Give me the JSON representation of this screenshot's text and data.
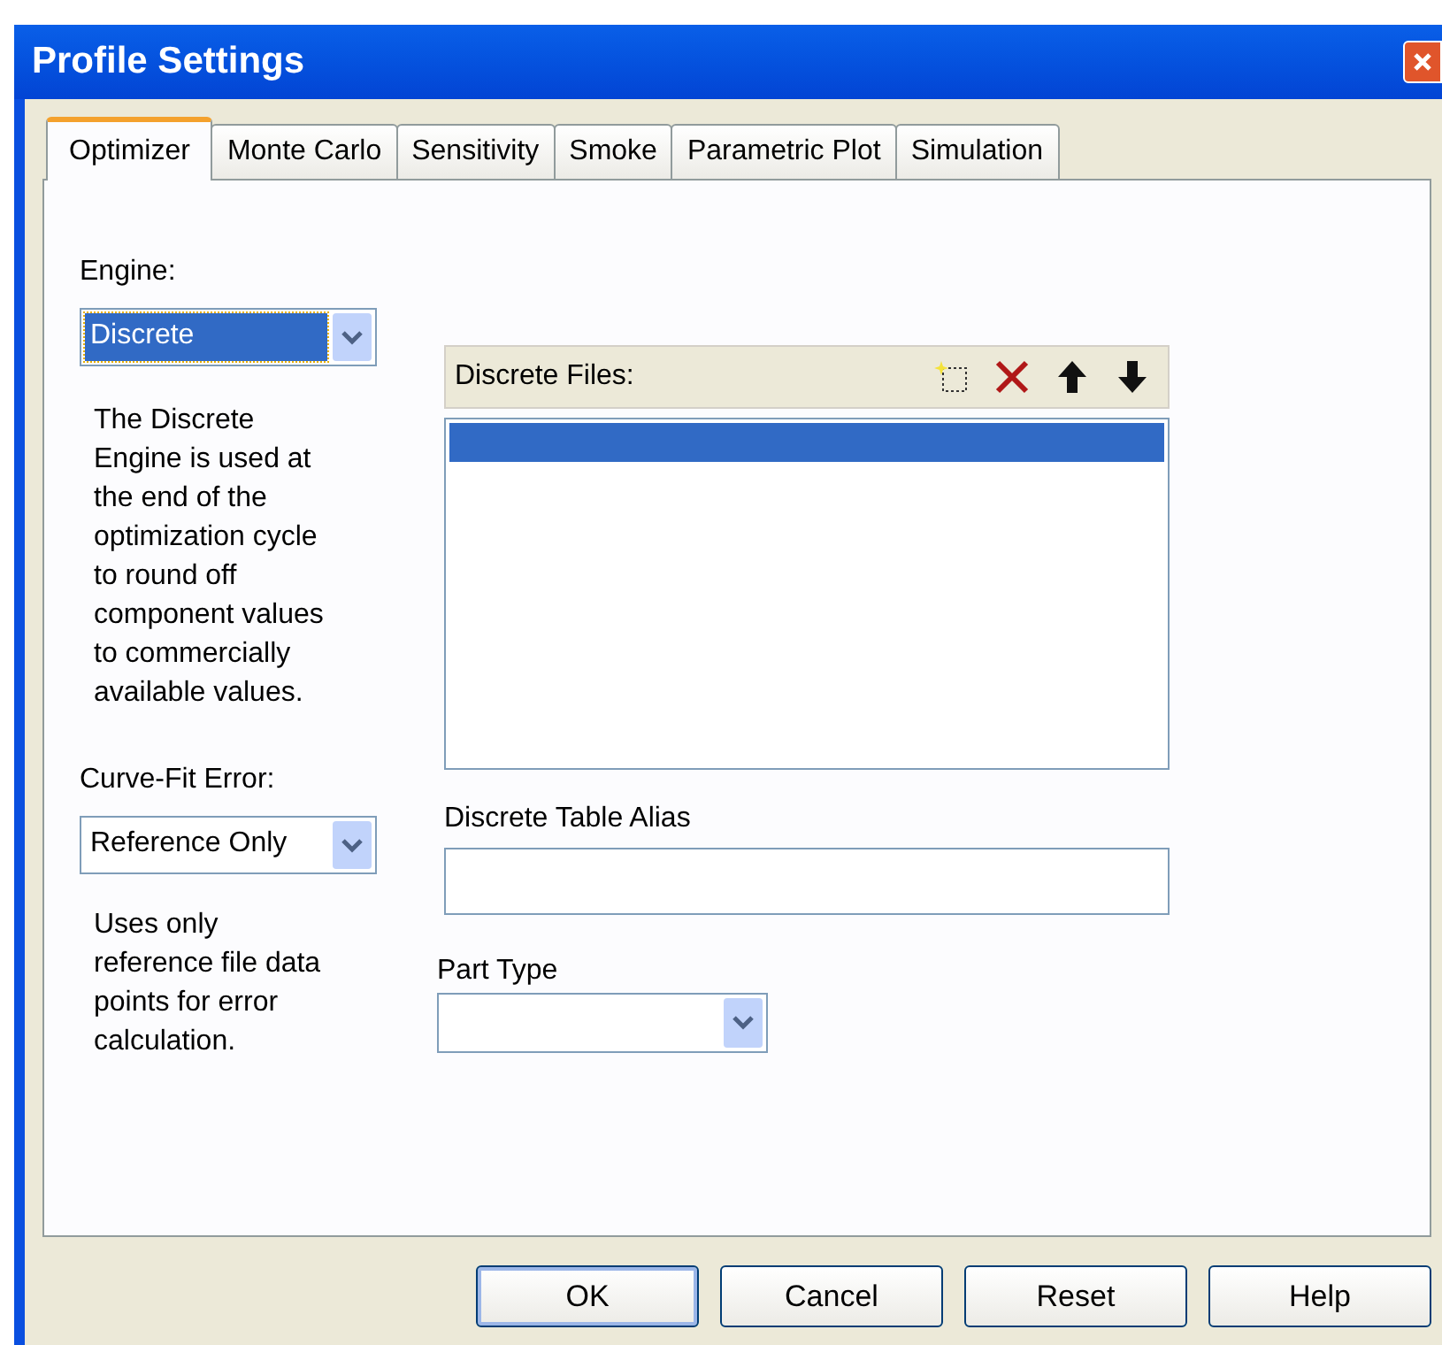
{
  "window": {
    "title": "Profile Settings"
  },
  "tabs": [
    {
      "label": "Optimizer",
      "selected": true
    },
    {
      "label": "Monte Carlo",
      "selected": false
    },
    {
      "label": "Sensitivity",
      "selected": false
    },
    {
      "label": "Smoke",
      "selected": false
    },
    {
      "label": "Parametric Plot",
      "selected": false
    },
    {
      "label": "Simulation",
      "selected": false
    }
  ],
  "engine": {
    "label": "Engine:",
    "value": "Discrete",
    "focused": true,
    "description": "The Discrete Engine is used at the end of the optimization cycle to round off component values to commercially available values."
  },
  "curve_fit_error": {
    "label": "Curve-Fit Error:",
    "value": "Reference Only",
    "focused": false,
    "description": "Uses only reference file data points for error calculation."
  },
  "discrete_files": {
    "label": "Discrete Files:",
    "rows": [
      {
        "selected": true
      }
    ]
  },
  "discrete_table_alias": {
    "label": "Discrete Table Alias"
  },
  "part_type": {
    "label": "Part Type"
  },
  "buttons": [
    {
      "label": "OK",
      "default": true
    },
    {
      "label": "Cancel",
      "default": false
    },
    {
      "label": "Reset",
      "default": false
    },
    {
      "label": "Help",
      "default": false
    }
  ]
}
